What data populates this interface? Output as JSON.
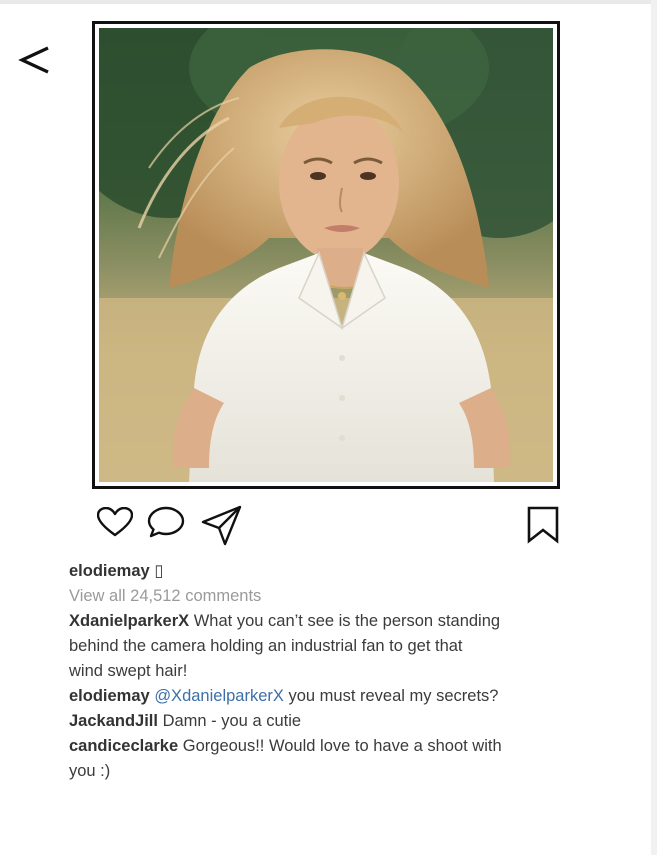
{
  "post": {
    "author": "elodiemay",
    "author_glyph": "▯",
    "view_comments": "View all 24,512 comments"
  },
  "comments": [
    {
      "user": "XdanielparkerX",
      "lines": [
        "What you can’t see is the person standing",
        "behind the camera holding an industrial fan to get that",
        "wind swept hair!"
      ]
    },
    {
      "user": "elodiemay",
      "mention": "@XdanielparkerX",
      "text": "you must reveal my secrets?"
    },
    {
      "user": "JackandJill",
      "text": "Damn - you a cutie"
    },
    {
      "user": "candiceclarke",
      "lines": [
        "Gorgeous!! Would love to have a shoot with",
        "you :)"
      ]
    }
  ],
  "icons": [
    "back-chevron-icon",
    "heart-icon",
    "comment-icon",
    "share-icon",
    "bookmark-icon"
  ],
  "colors": {
    "mention": "#3d6fa8",
    "meta": "#9a9a9a",
    "text": "#3b3b3b"
  }
}
